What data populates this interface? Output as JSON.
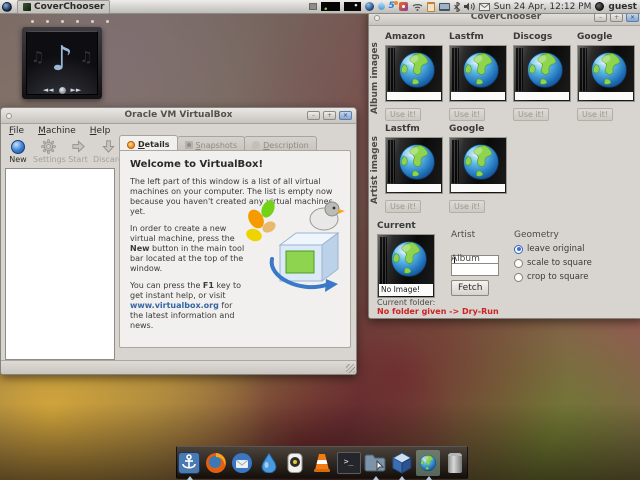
{
  "panel": {
    "taskbar_label": "CoverChooser",
    "clock": "Sun 24 Apr, 12:12 PM",
    "user": "guest",
    "tray_icons": [
      "window-list",
      "cpu-graph",
      "net-graph",
      "globe",
      "drop",
      "five",
      "photo",
      "clipboard",
      "display",
      "volume",
      "mail"
    ]
  },
  "music_widget": {
    "control_icons": [
      "previous-icon",
      "stop-icon",
      "next-icon"
    ]
  },
  "virtualbox": {
    "title": "Oracle VM VirtualBox",
    "menus": [
      "File",
      "Machine",
      "Help"
    ],
    "toolbar": [
      {
        "label": "New",
        "icon": "new",
        "enabled": true
      },
      {
        "label": "Settings",
        "icon": "gear",
        "enabled": false
      },
      {
        "label": "Start",
        "icon": "start",
        "enabled": false
      },
      {
        "label": "Discard",
        "icon": "discard",
        "enabled": false
      }
    ],
    "tabs": [
      {
        "label": "Details",
        "icon": "details",
        "active": true
      },
      {
        "label": "Snapshots",
        "icon": "snapshots",
        "active": false
      },
      {
        "label": "Description",
        "icon": "description",
        "active": false
      }
    ],
    "welcome": {
      "title": "Welcome to VirtualBox!",
      "p1": "The left part of this window is a list of all virtual machines on your computer. The list is empty now because you haven't created any virtual machines yet.",
      "p2_pre": "In order to create a new virtual machine, press the ",
      "p2_bold": "New",
      "p2_post": " button in the main tool bar located at the top of the window.",
      "p3_pre": "You can press the ",
      "p3_bold": "F1",
      "p3_mid": " key to get instant help, or visit ",
      "p3_link": "www.virtualbox.org",
      "p3_post": " for the latest information and news."
    }
  },
  "cover_chooser": {
    "title": "CoverChooser",
    "album_row_label": "Album images",
    "artist_row_label": "Artist images",
    "album_sources": [
      "Amazon",
      "Lastfm",
      "Discogs",
      "Google"
    ],
    "artist_sources": [
      "Lastfm",
      "Google"
    ],
    "use_button_label": "Use it!",
    "current_label": "Current",
    "no_image_label": "No Image!",
    "artist_field_label": "Artist",
    "artist_field_value": "",
    "album_field_label": "Album",
    "album_field_value": "",
    "fetch_button_label": "Fetch",
    "geometry_label": "Geometry",
    "geometry_options": [
      "leave original",
      "scale to square",
      "crop to square"
    ],
    "geometry_selected": "leave original",
    "folder_label": "Current folder:",
    "folder_status": "No folder given -> Dry-Run",
    "accent_red": "#cc2222"
  },
  "dock": {
    "items": [
      {
        "name": "docky",
        "indicator": true,
        "active": false
      },
      {
        "name": "firefox",
        "indicator": false,
        "active": false
      },
      {
        "name": "thunderbird",
        "indicator": false,
        "active": false
      },
      {
        "name": "deluge",
        "indicator": false,
        "active": false
      },
      {
        "name": "camera",
        "indicator": false,
        "active": false
      },
      {
        "name": "vlc",
        "indicator": false,
        "active": false
      },
      {
        "name": "terminal",
        "indicator": false,
        "active": false
      },
      {
        "name": "files",
        "indicator": true,
        "active": false
      },
      {
        "name": "virtualbox",
        "indicator": true,
        "active": false
      },
      {
        "name": "coverchooser",
        "indicator": true,
        "active": true
      },
      {
        "name": "trash",
        "indicator": false,
        "active": false
      }
    ]
  }
}
